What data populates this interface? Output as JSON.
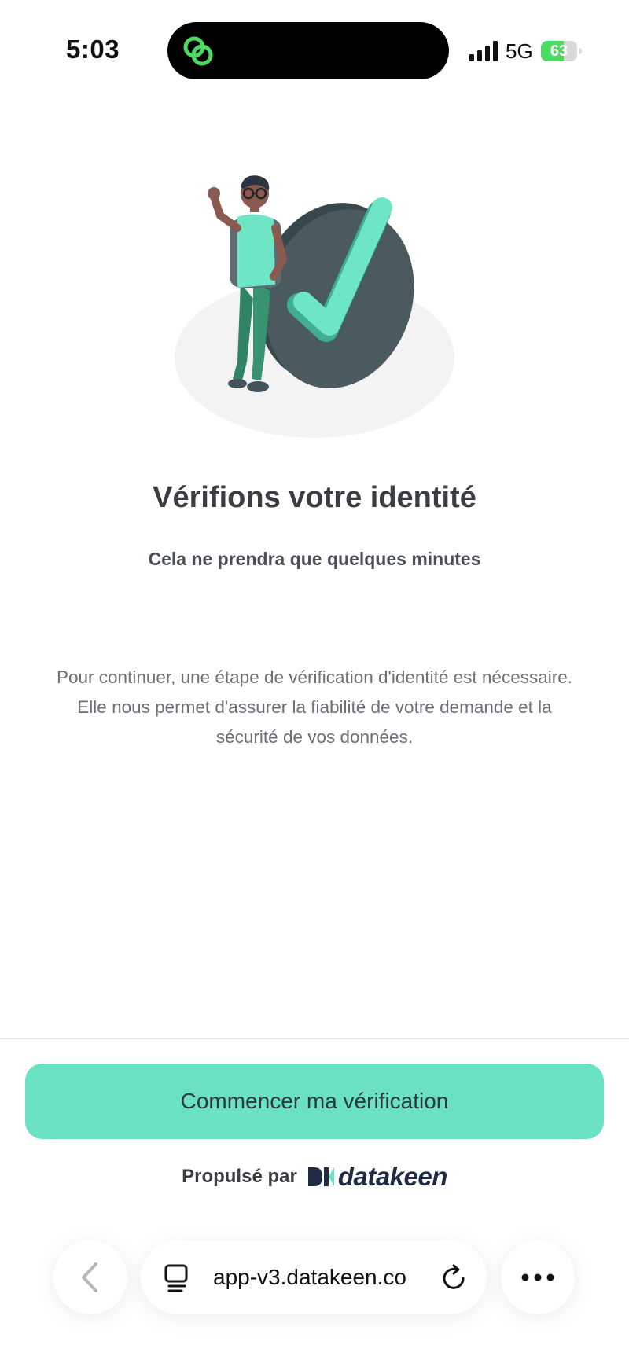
{
  "status_bar": {
    "time": "5:03",
    "network": "5G",
    "battery_percent": 63,
    "battery_label": "63",
    "icons": [
      "signal-icon",
      "battery-charging-icon",
      "app-link-icon"
    ]
  },
  "page": {
    "illustration": "identity-verified-illustration",
    "title": "Vérifions votre identité",
    "subtitle": "Cela ne prendra que quelques minutes",
    "description": "Pour continuer, une étape de vérification d'identité est nécessaire. Elle nous permet d'assurer la fiabilité de votre demande et la sécurité de vos données."
  },
  "footer": {
    "cta_label": "Commencer ma vérification",
    "powered_by": "Propulsé par",
    "brand": "datakeen"
  },
  "browser": {
    "url": "app-v3.datakeen.co",
    "icons": [
      "back-icon",
      "tabs-icon",
      "reload-icon",
      "more-icon"
    ]
  },
  "colors": {
    "accent": "#69e1c2",
    "text": "#3a3d42",
    "muted": "#6b6f76",
    "brand": "#1f2a44"
  }
}
